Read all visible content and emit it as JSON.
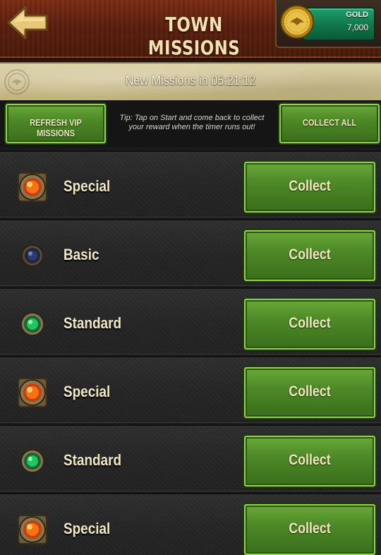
{
  "header": {
    "title": "TOWN MISSIONS",
    "back_icon": "back-arrow-icon",
    "gold": {
      "label": "GOLD",
      "value": "7,000",
      "icon": "gold-coin-icon"
    }
  },
  "banner": {
    "text": "New Missions in 05:21:12",
    "icon": "seal-emblem-icon"
  },
  "actions": {
    "refresh_label": "REFRESH VIP MISSIONS",
    "tip": "Tip: Tap on Start and come back to collect your reward when the timer runs out!",
    "collect_all_label": "COLLECT ALL"
  },
  "missions": [
    {
      "type": "Special",
      "gem": "special-gem-icon",
      "button": "Collect"
    },
    {
      "type": "Basic",
      "gem": "basic-gem-icon",
      "button": "Collect"
    },
    {
      "type": "Standard",
      "gem": "standard-gem-icon",
      "button": "Collect"
    },
    {
      "type": "Special",
      "gem": "special-gem-icon",
      "button": "Collect"
    },
    {
      "type": "Standard",
      "gem": "standard-gem-icon",
      "button": "Collect"
    },
    {
      "type": "Special",
      "gem": "special-gem-icon",
      "button": "Collect"
    }
  ],
  "colors": {
    "header_bg": "#5a1f0d",
    "title_text": "#f3e2b0",
    "button_green": "#4d8a27",
    "button_border": "#93d14f",
    "gold_bar": "#11794b"
  }
}
